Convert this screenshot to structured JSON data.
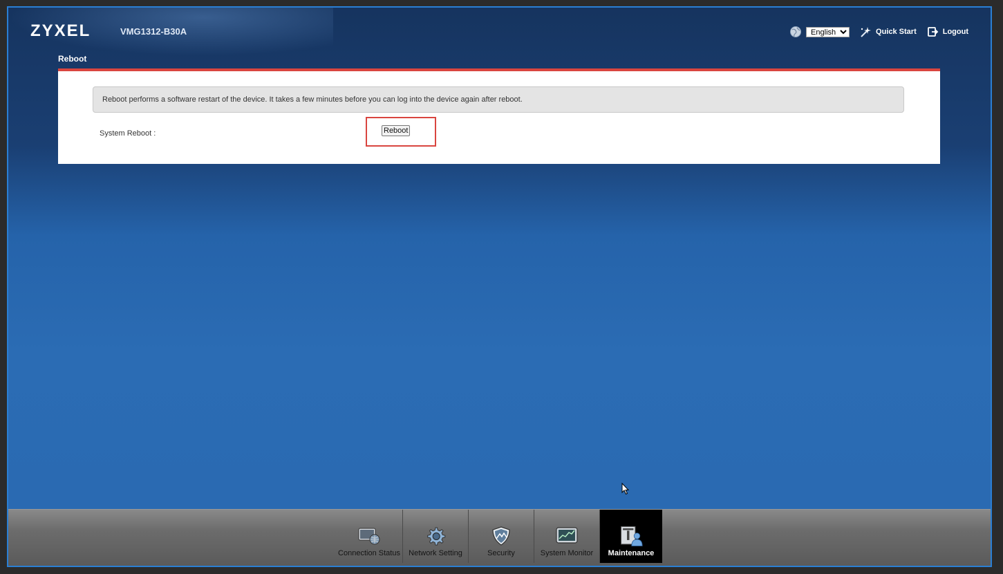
{
  "header": {
    "brand": "ZYXEL",
    "model": "VMG1312-B30A",
    "language": {
      "selected": "English",
      "options": [
        "English"
      ]
    },
    "quick_start": "Quick Start",
    "logout": "Logout"
  },
  "page": {
    "title": "Reboot",
    "info": "Reboot performs a software restart of the device. It takes a few minutes before you can log into the device again after reboot.",
    "system_reboot_label": "System Reboot :",
    "reboot_button": "Reboot"
  },
  "nav": {
    "items": [
      {
        "label": "Connection Status",
        "icon": "connection-status-icon"
      },
      {
        "label": "Network Setting",
        "icon": "gear-icon"
      },
      {
        "label": "Security",
        "icon": "shield-icon"
      },
      {
        "label": "System Monitor",
        "icon": "monitor-chart-icon"
      },
      {
        "label": "Maintenance",
        "icon": "maintenance-icon",
        "active": true
      }
    ]
  },
  "colors": {
    "accent_red": "#d9453f",
    "frame_blue": "#2a7fd4"
  }
}
